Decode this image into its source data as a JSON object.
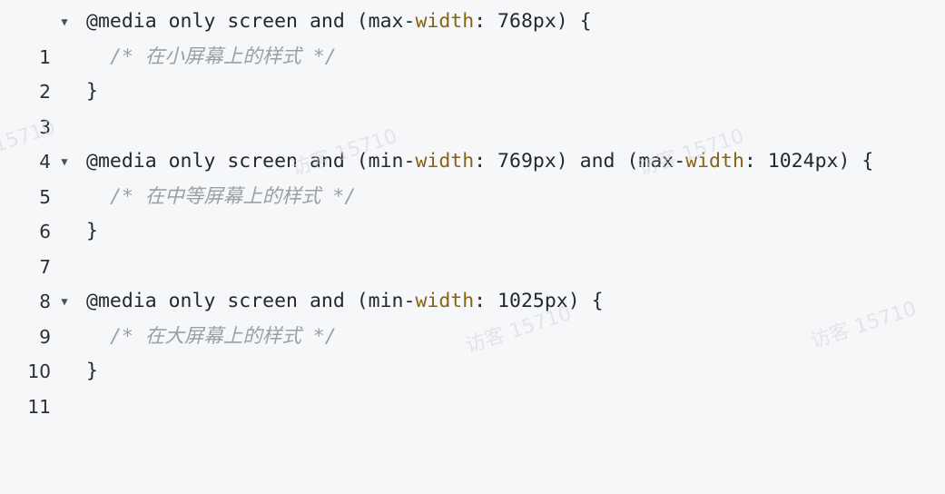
{
  "editor": {
    "lines": [
      {
        "num": "1",
        "fold": "▼",
        "parts": [
          "@media only screen and (max-",
          "width",
          ": 768px) {"
        ]
      },
      {
        "num": "2",
        "fold": "",
        "comment": "/* 在小屏幕上的样式 */"
      },
      {
        "num": "3",
        "fold": "",
        "text": "}"
      },
      {
        "num": "4",
        "fold": "",
        "text": ""
      },
      {
        "num": "5",
        "fold": "▼",
        "parts": [
          "@media only screen and (min-",
          "width",
          ": 769px) and (max-",
          "width",
          ": 1024px) {"
        ]
      },
      {
        "num": "6",
        "fold": "",
        "comment": "/* 在中等屏幕上的样式 */"
      },
      {
        "num": "7",
        "fold": "",
        "text": "}"
      },
      {
        "num": "8",
        "fold": "",
        "text": ""
      },
      {
        "num": "9",
        "fold": "▼",
        "parts": [
          "@media only screen and (min-",
          "width",
          ": 1025px) {"
        ]
      },
      {
        "num": "10",
        "fold": "",
        "comment": "/* 在大屏幕上的样式 */"
      },
      {
        "num": "11",
        "fold": "",
        "text": "}"
      }
    ]
  },
  "watermark": {
    "text": "访客 15710",
    "partial": "15710"
  },
  "colors": {
    "background": "#f6f7f9",
    "property": "#8a6212",
    "comment": "#9aa0a6",
    "text": "#24292f"
  }
}
